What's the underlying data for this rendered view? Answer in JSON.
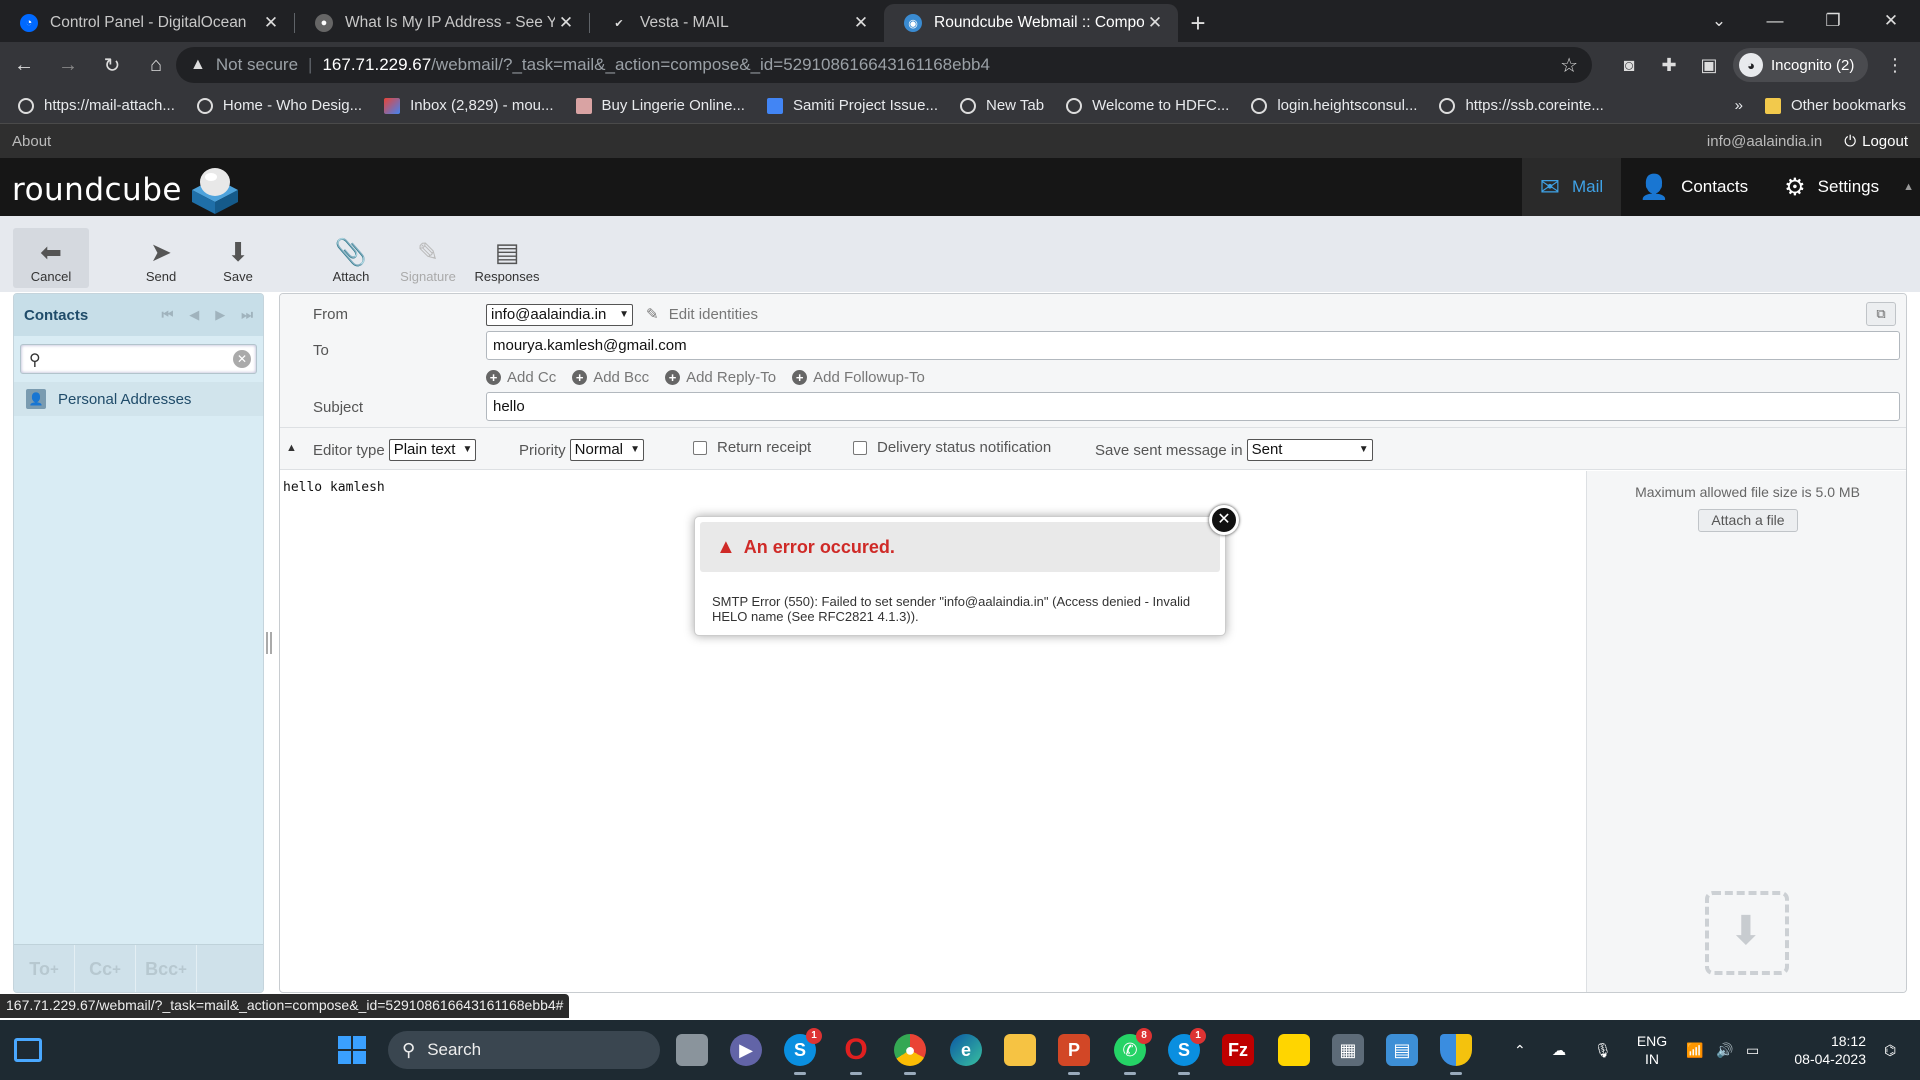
{
  "browser": {
    "tabs": [
      {
        "title": "Control Panel - DigitalOcean",
        "color": "#0069ff"
      },
      {
        "title": "What Is My IP Address - See Your",
        "color": "#bbbbbb"
      },
      {
        "title": "Vesta - MAIL",
        "color": "#e0e0e0"
      },
      {
        "title": "Roundcube Webmail :: Compose",
        "color": "#3a8bd1"
      }
    ],
    "security_label": "Not secure",
    "url_host": "167.71.229.67",
    "url_path": "/webmail/?_task=mail&_action=compose&_id=529108616643161168ebb4",
    "profile_label": "Incognito (2)",
    "bookmarks": [
      "https://mail-attach...",
      "Home - Who Desig...",
      "Inbox (2,829) - mou...",
      "Buy Lingerie Online...",
      "Samiti Project Issue...",
      "New Tab",
      "Welcome to HDFC...",
      "login.heightsconsul...",
      "https://ssb.coreinte..."
    ],
    "bookmarks_overflow": "»",
    "other_bookmarks": "Other bookmarks",
    "status_url": "167.71.229.67/webmail/?_task=mail&_action=compose&_id=529108616643161168ebb4#"
  },
  "roundcube": {
    "about": "About",
    "user_email": "info@aalaindia.in",
    "logout": "Logout",
    "logo_text": "roundcube",
    "tasks": {
      "mail": "Mail",
      "contacts": "Contacts",
      "settings": "Settings"
    },
    "toolbar": {
      "cancel": "Cancel",
      "send": "Send",
      "save": "Save",
      "attach": "Attach",
      "signature": "Signature",
      "responses": "Responses"
    },
    "contacts_panel": {
      "title": "Contacts",
      "address_book": "Personal Addresses",
      "to": "To",
      "cc": "Cc",
      "bcc": "Bcc"
    },
    "compose": {
      "from_label": "From",
      "from_value": "info@aalaindia.in",
      "edit_identities": "Edit identities",
      "to_label": "To",
      "to_value": "mourya.kamlesh@gmail.com",
      "add_cc": "Add Cc",
      "add_bcc": "Add Bcc",
      "add_reply_to": "Add Reply-To",
      "add_followup_to": "Add Followup-To",
      "subject_label": "Subject",
      "subject_value": "hello",
      "editor_type_label": "Editor type",
      "editor_type_value": "Plain text",
      "priority_label": "Priority",
      "priority_value": "Normal",
      "return_receipt": "Return receipt",
      "delivery_status": "Delivery status notification",
      "save_sent_label": "Save sent message in",
      "save_sent_value": "Sent",
      "body": "hello kamlesh",
      "max_file_size": "Maximum allowed file size is 5.0 MB",
      "attach_file": "Attach a file"
    },
    "error_dialog": {
      "title": "An error occured.",
      "message": "SMTP Error (550): Failed to set sender \"info@aalaindia.in\" (Access denied - Invalid HELO name (See RFC2821 4.1.3))."
    }
  },
  "taskbar": {
    "search_label": "Search",
    "lang_line1": "ENG",
    "lang_line2": "IN",
    "time": "18:12",
    "date": "08-04-2023",
    "skype_badge": "1",
    "whatsapp_badge": "8",
    "skype2_badge": "1"
  },
  "colors": {
    "accent_blue": "#3fa2e6",
    "error_red": "#cf2a27",
    "contacts_bg": "#d9ecf4"
  }
}
